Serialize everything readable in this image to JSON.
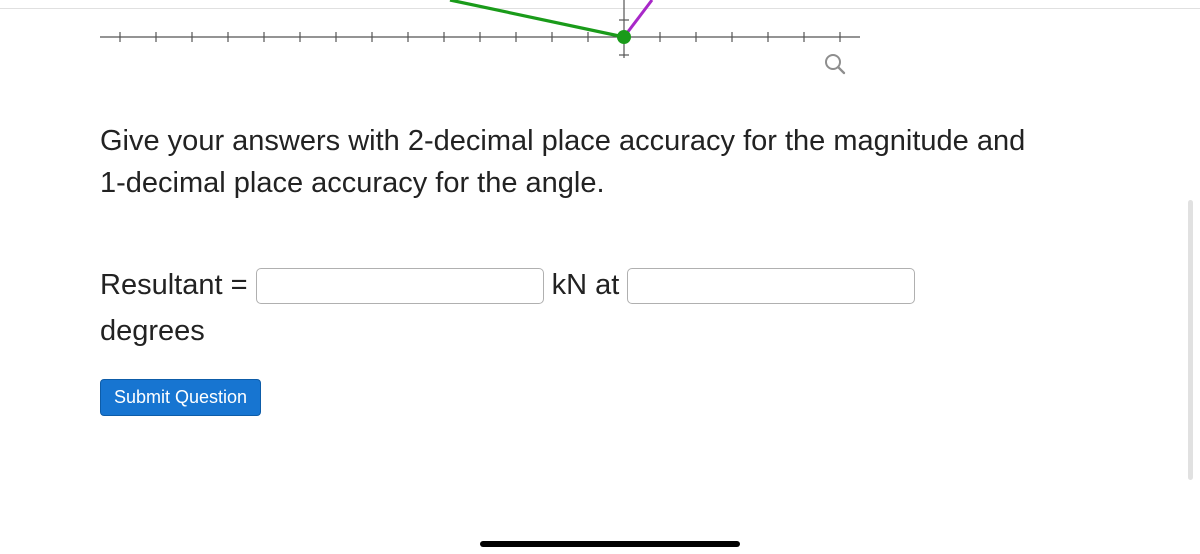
{
  "instruction": "Give your answers with 2-decimal place accuracy for the magnitude and 1-decimal place accuracy for the angle.",
  "answer": {
    "label_prefix": "Resultant = ",
    "magnitude_value": "",
    "unit_text": " kN at ",
    "angle_value": "",
    "label_suffix": "degrees"
  },
  "buttons": {
    "submit": "Submit Question"
  },
  "icons": {
    "magnifier": "search-icon"
  }
}
